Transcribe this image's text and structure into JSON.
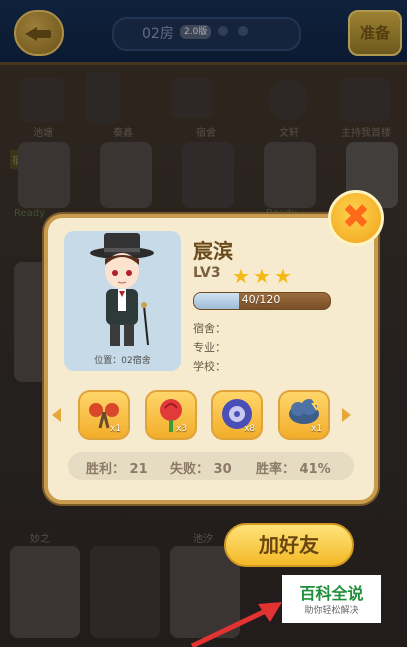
{
  "header": {
    "room": "02房",
    "room_badge": "2.0版",
    "ready_label": "准备"
  },
  "background": {
    "top_labels": [
      "池塘",
      "秦鑫",
      "宿舍",
      "文轩",
      "主持我首楼"
    ],
    "bottom_labels": [
      "妙之",
      "池汐"
    ],
    "side_tag": "宿舍",
    "ready_tag": "Ready"
  },
  "profile": {
    "name": "宸滨",
    "level": "LV3",
    "stars": 3,
    "xp_text": "40/120",
    "xp_fraction": 0.333,
    "location": "位置：02宿舍",
    "dorm_label": "宿舍：",
    "major_label": "专业：",
    "school_label": "学校："
  },
  "items": [
    {
      "icon": "scissors-bug-icon",
      "count": "x1"
    },
    {
      "icon": "rose-icon",
      "count": "x3"
    },
    {
      "icon": "alien-ball-icon",
      "count": "x8"
    },
    {
      "icon": "storm-cloud-icon",
      "count": "x1"
    }
  ],
  "stats": {
    "wins": "胜利：  21",
    "losses": "失败：  30",
    "rate": "胜率：  41%"
  },
  "buttons": {
    "close": "✖",
    "add_friend": "加好友"
  },
  "watermark": {
    "title": "百科全说",
    "subtitle": "助你轻松解决"
  },
  "colors": {
    "accent": "#f3b927",
    "watermark_green": "#1f8e3a",
    "close_x": "#ff6a1a"
  }
}
